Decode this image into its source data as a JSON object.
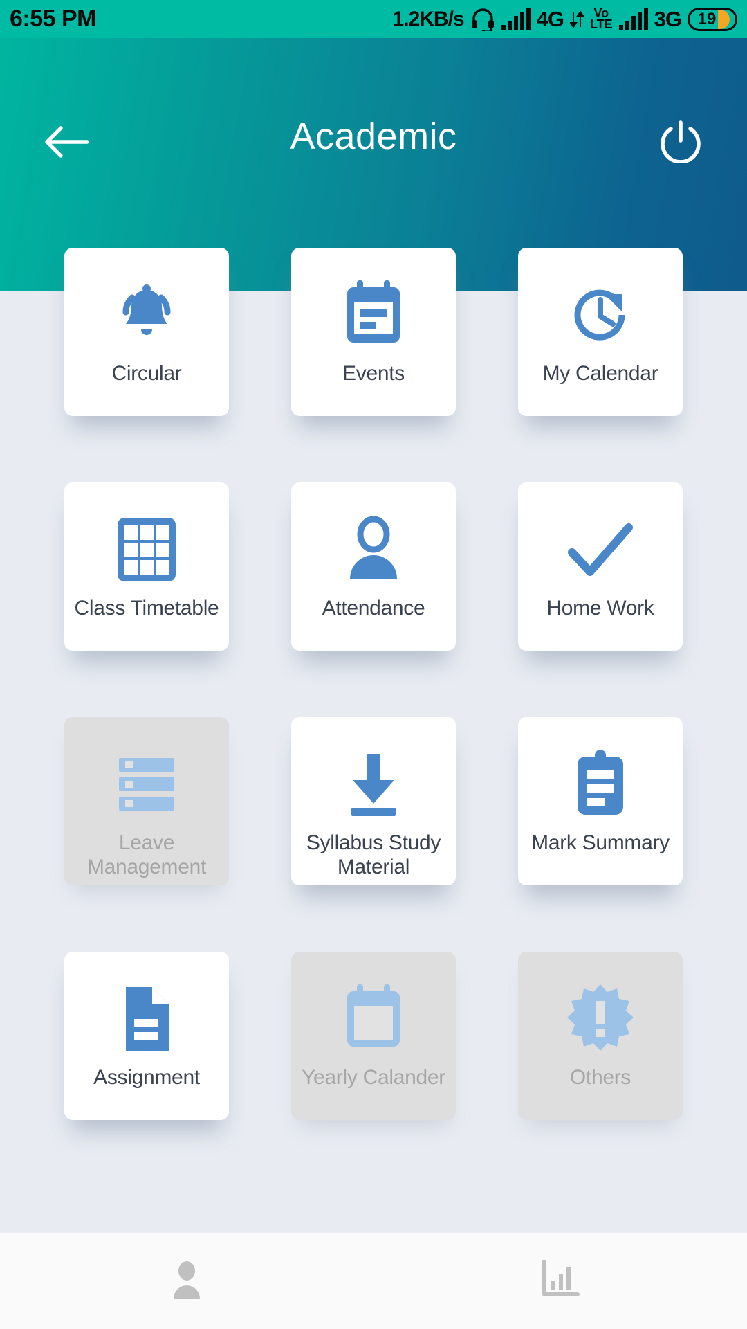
{
  "status_bar": {
    "time": "6:55 PM",
    "network_speed": "1.2KB/s",
    "headset_icon": "headset-icon",
    "sim1_signal_icon": "signal-bars-icon",
    "sim1_network": "4G",
    "data_arrows_icon": "data-transfer-icon",
    "volte_top": "Vo",
    "volte_bottom": "LTE",
    "sim2_signal_icon": "signal-bars-icon",
    "sim2_network": "3G",
    "battery_percent": "19"
  },
  "header": {
    "back_icon": "arrow-left-icon",
    "title": "Academic",
    "power_icon": "power-icon",
    "gradient_start": "#00b5a0",
    "gradient_end": "#0f5b8c"
  },
  "theme": {
    "accent_blue": "#4a87c8",
    "disabled_blue": "#9dc2e8",
    "background": "#e8ecf2",
    "card_background": "#ffffff",
    "card_disabled_background": "#dedede",
    "label_color": "#3b4250",
    "label_disabled_color": "#a6a6a6"
  },
  "grid": {
    "items": [
      {
        "label": "Circular",
        "icon": "bell-icon",
        "enabled": true
      },
      {
        "label": "Events",
        "icon": "calendar-lines-icon",
        "enabled": true
      },
      {
        "label": "My Calendar",
        "icon": "clock-refresh-icon",
        "enabled": true
      },
      {
        "label": "Class Timetable",
        "icon": "grid-table-icon",
        "enabled": true
      },
      {
        "label": "Attendance",
        "icon": "person-icon",
        "enabled": true
      },
      {
        "label": "Home Work",
        "icon": "check-icon",
        "enabled": true
      },
      {
        "label": "Leave Management",
        "icon": "list-rows-icon",
        "enabled": false
      },
      {
        "label": "Syllabus Study Material",
        "icon": "download-icon",
        "enabled": true
      },
      {
        "label": "Mark Summary",
        "icon": "clipboard-icon",
        "enabled": true
      },
      {
        "label": "Assignment",
        "icon": "document-icon",
        "enabled": true
      },
      {
        "label": "Yearly Calander",
        "icon": "calendar-blank-icon",
        "enabled": false
      },
      {
        "label": "Others",
        "icon": "starburst-alert-icon",
        "enabled": false
      }
    ]
  },
  "bottom_nav": {
    "items": [
      {
        "icon": "profile-icon"
      },
      {
        "icon": "bar-chart-icon"
      }
    ]
  }
}
